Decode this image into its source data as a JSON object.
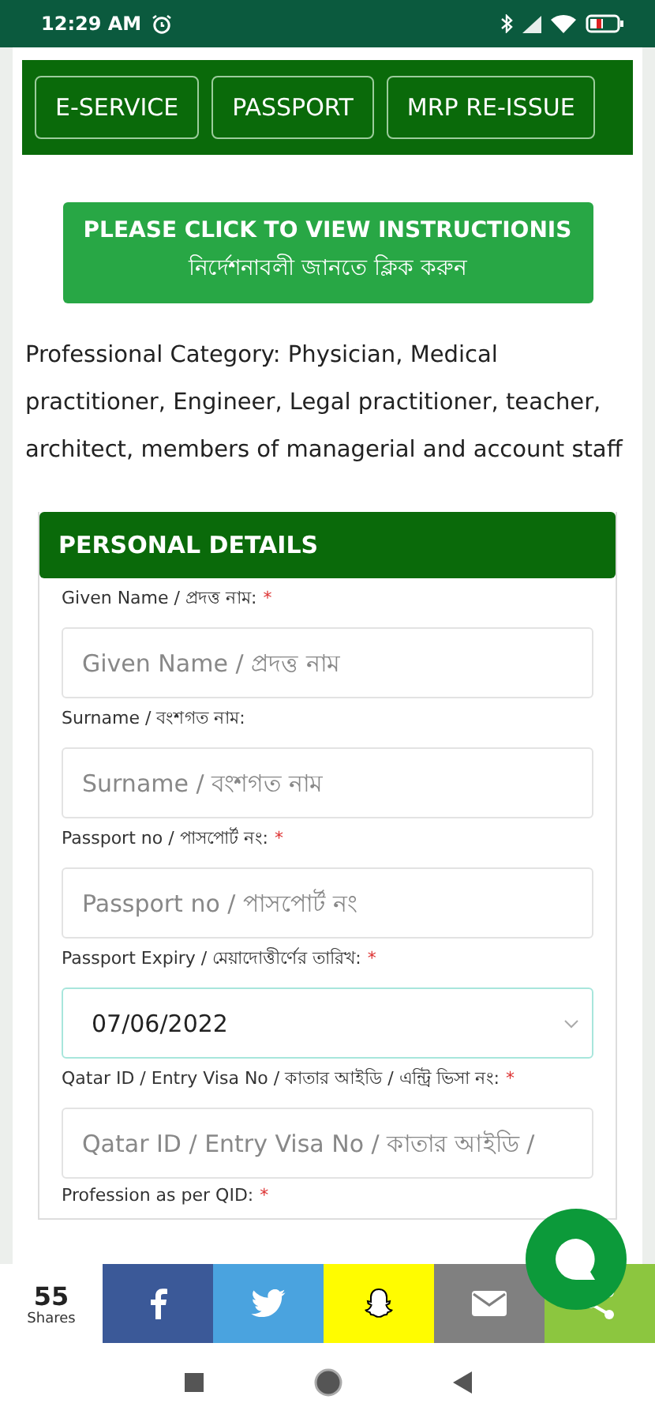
{
  "status_bar": {
    "time": "12:29 AM"
  },
  "nav_tabs": [
    {
      "label": "E-SERVICE"
    },
    {
      "label": "PASSPORT"
    },
    {
      "label": "MRP RE-ISSUE"
    }
  ],
  "instruction_button": {
    "lines": [
      "PLEASE CLICK TO VIEW INSTRUCTIONIS",
      "নির্দেশনাবলী জানতে ক্লিক করুন"
    ]
  },
  "description": "Professional Category: Physician, Medical practitioner, Engineer, Legal practitioner, teacher, architect, members of managerial and account staff",
  "form": {
    "title": "PERSONAL DETAILS",
    "required_mark": "*",
    "fields": [
      {
        "kind": "text",
        "label": "Given Name / প্রদত্ত নাম:",
        "required": true,
        "placeholder": "Given Name / প্রদত্ত নাম"
      },
      {
        "kind": "text",
        "label": "Surname / বংশগত নাম:",
        "required": false,
        "placeholder": "Surname / বংশগত নাম"
      },
      {
        "kind": "text",
        "label": "Passport no / পাসপোর্ট নং:",
        "required": true,
        "placeholder": "Passport no / পাসপোর্ট নং"
      },
      {
        "kind": "date",
        "label": "Passport Expiry / মেয়াদোত্তীর্ণের তারিখ:",
        "required": true,
        "value": "07/06/2022"
      },
      {
        "kind": "text",
        "label": "Qatar ID / Entry Visa No / কাতার আইডি / এন্ট্রি ভিসা নং:",
        "required": true,
        "placeholder": "Qatar ID / Entry Visa No / কাতার আইডি /"
      },
      {
        "kind": "label",
        "label": "Profession as per QID:",
        "required": true
      }
    ]
  },
  "share_bar": {
    "count": "55",
    "caption": "Shares",
    "buttons": [
      {
        "kind": "facebook"
      },
      {
        "kind": "twitter"
      },
      {
        "kind": "snapchat"
      },
      {
        "kind": "email"
      },
      {
        "kind": "share"
      }
    ]
  }
}
